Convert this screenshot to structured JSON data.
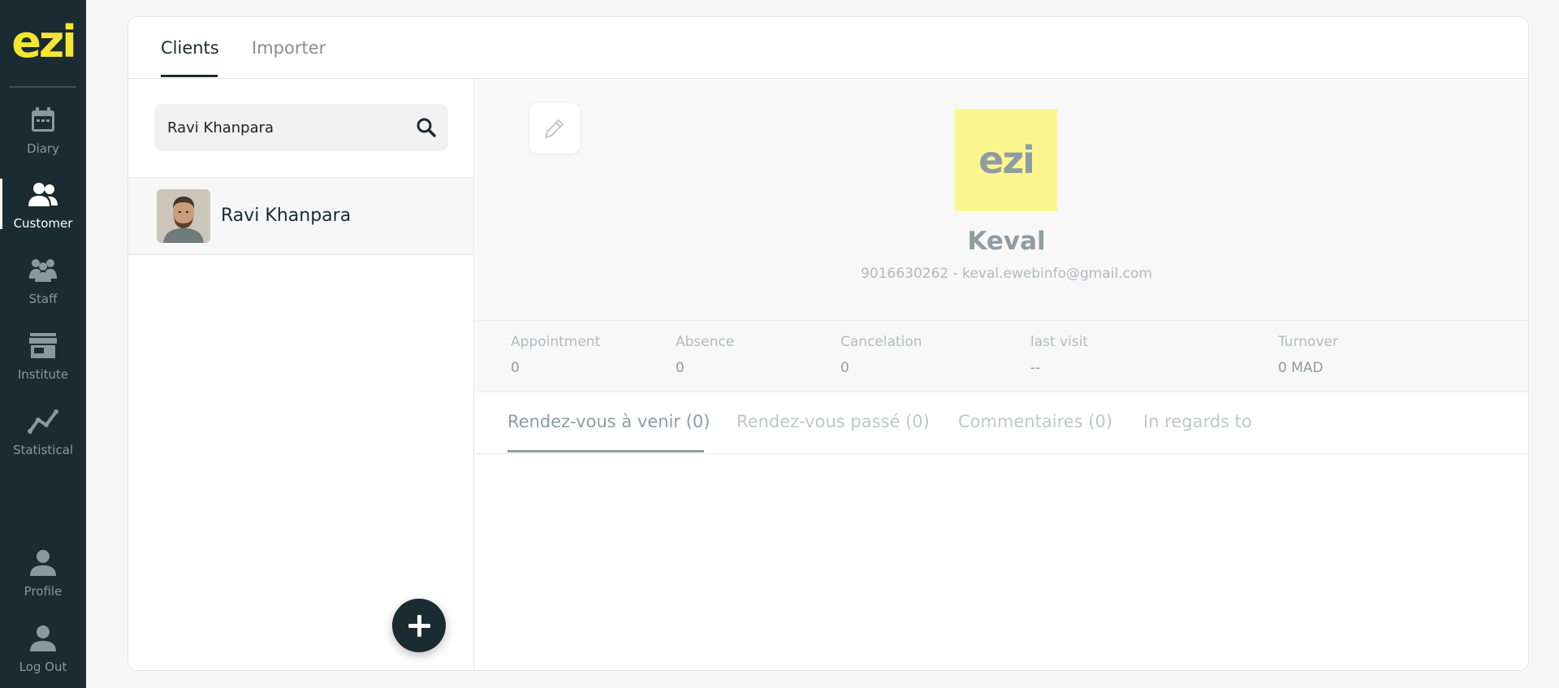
{
  "app": {
    "logo": "ezi"
  },
  "sidebar": {
    "items": [
      {
        "label": "Diary",
        "icon": "calendar-icon"
      },
      {
        "label": "Customer",
        "icon": "users-icon",
        "active": true
      },
      {
        "label": "Staff",
        "icon": "staff-icon"
      },
      {
        "label": "Institute",
        "icon": "store-icon"
      },
      {
        "label": "Statistical",
        "icon": "chart-line-icon"
      }
    ],
    "bottom": [
      {
        "label": "Profile",
        "icon": "person-icon"
      },
      {
        "label": "Log Out",
        "icon": "logout-person-icon"
      }
    ]
  },
  "tabs": [
    {
      "label": "Clients",
      "active": true
    },
    {
      "label": "Importer",
      "active": false
    }
  ],
  "search": {
    "value": "Ravi Khanpara",
    "icon": "search-icon"
  },
  "clients": [
    {
      "name": "Ravi Khanpara",
      "avatar": "avatar-photo"
    }
  ],
  "add_button": {
    "icon": "plus-icon"
  },
  "profile": {
    "edit_icon": "pencil-icon",
    "picture_text": "ezi",
    "name": "Keval",
    "contact": "9016630262 - keval.ewebinfo@gmail.com"
  },
  "stats": {
    "appointment": {
      "label": "Appointment",
      "value": "0"
    },
    "absence": {
      "label": "Absence",
      "value": "0"
    },
    "cancelation": {
      "label": "Cancelation",
      "value": "0"
    },
    "last_visit": {
      "label": "last visit",
      "value": "--"
    },
    "turnover": {
      "label": "Turnover",
      "value": "0 MAD"
    }
  },
  "subtabs": [
    {
      "label": "Rendez-vous à venir (0)",
      "active": true
    },
    {
      "label": "Rendez-vous passé (0)",
      "active": false
    },
    {
      "label": "Commentaires (0)",
      "active": false
    },
    {
      "label": "In regards to",
      "active": false
    }
  ],
  "colors": {
    "sidebar_bg": "#1b2b32",
    "logo_yellow": "#f5e632",
    "accent_dark": "#1b2b32",
    "muted_text": "#8f9ca2",
    "placeholder_yellow": "#fbf78e"
  }
}
